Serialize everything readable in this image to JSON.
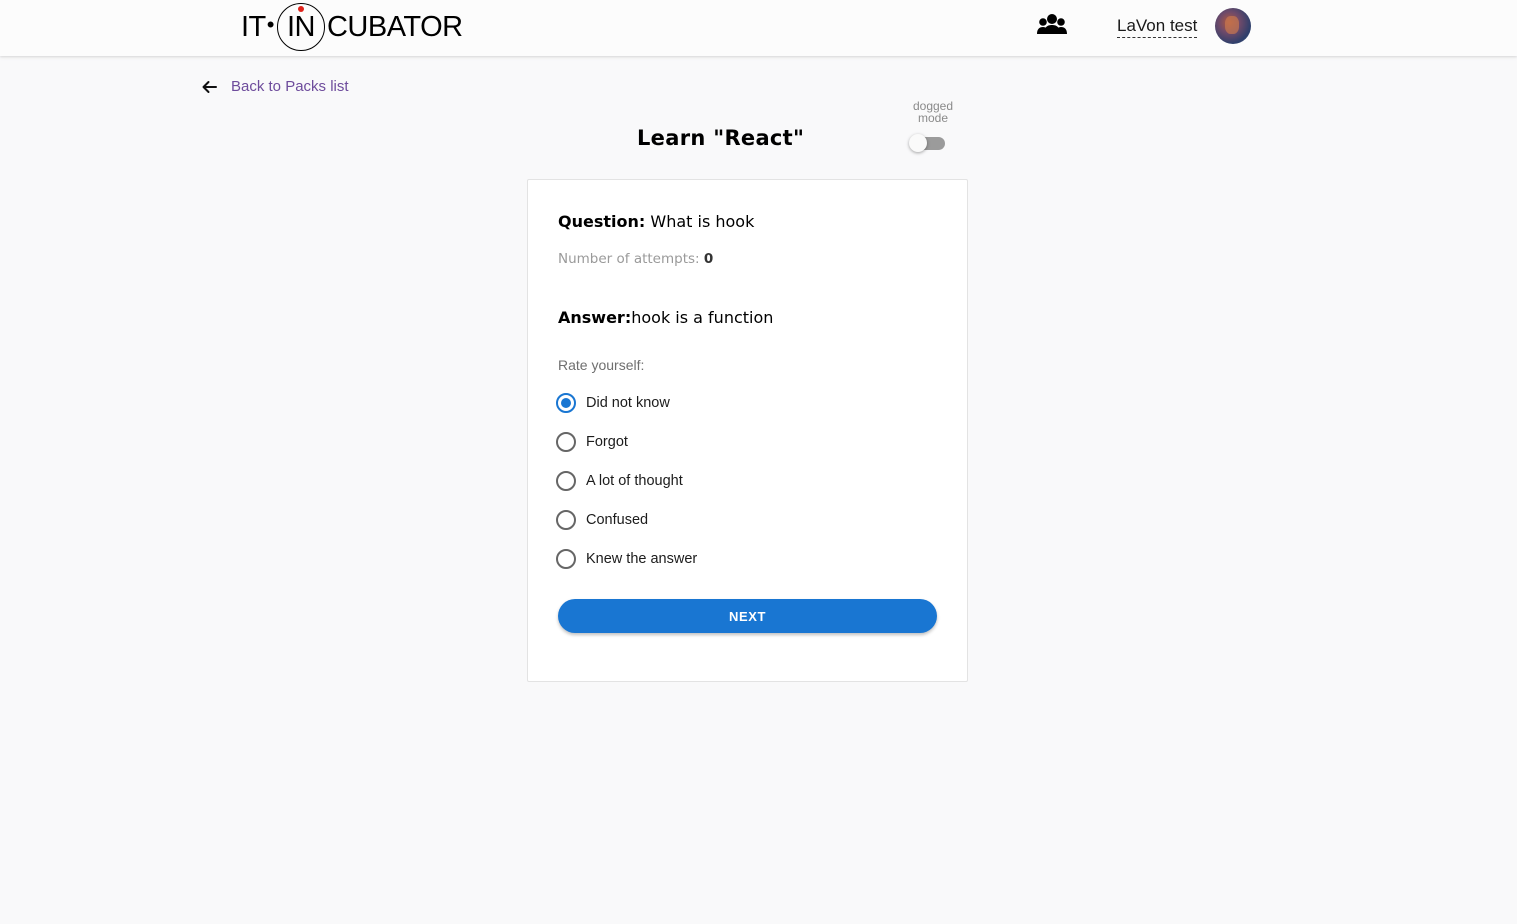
{
  "header": {
    "logo": {
      "part1": "IT",
      "part2": "IN",
      "part3": "CUBATOR"
    },
    "users_icon": "users-group-icon",
    "user_name": "LaVon test"
  },
  "nav": {
    "back_label": "Back to Packs list",
    "back_icon": "arrow-left-icon"
  },
  "page": {
    "title": "Learn \"React\"",
    "mode_label_line1": "dogged",
    "mode_label_line2": "mode",
    "dogged_mode_on": false
  },
  "card": {
    "question_label": "Question:",
    "question_text": " What is hook",
    "attempts_label": "Number of attempts: ",
    "attempts_value": "0",
    "answer_label": "Answer:",
    "answer_text": "hook is a function",
    "rate_label": "Rate yourself:",
    "options": [
      {
        "label": "Did not know",
        "checked": true
      },
      {
        "label": "Forgot",
        "checked": false
      },
      {
        "label": "A lot of thought",
        "checked": false
      },
      {
        "label": "Confused",
        "checked": false
      },
      {
        "label": "Knew the answer",
        "checked": false
      }
    ],
    "next_label": "NEXT"
  },
  "colors": {
    "accent": "#1976d2",
    "link": "#6e4c9c",
    "background": "#f9f9fa",
    "logo_dot": "#e0231b"
  }
}
